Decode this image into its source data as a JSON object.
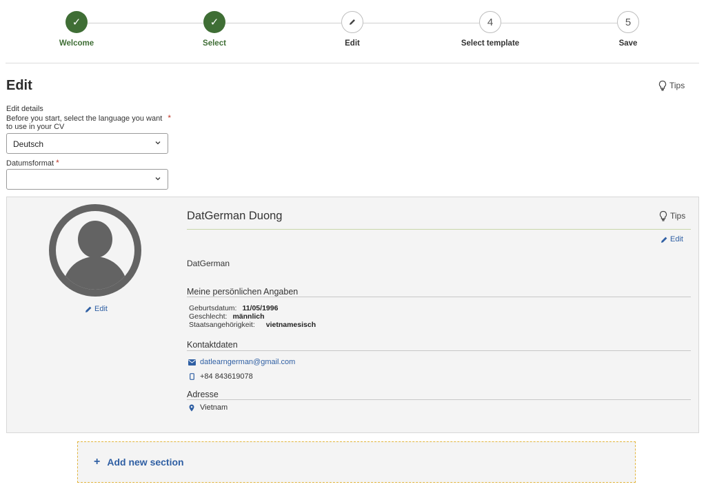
{
  "stepper": {
    "steps": [
      {
        "label": "Welcome",
        "state": "done",
        "symbol": "✓"
      },
      {
        "label": "Select",
        "state": "done",
        "symbol": "✓"
      },
      {
        "label": "Edit",
        "state": "active",
        "symbol": "pencil-icon"
      },
      {
        "label": "Select template",
        "state": "todo",
        "symbol": "4"
      },
      {
        "label": "Save",
        "state": "todo",
        "symbol": "5"
      }
    ]
  },
  "page": {
    "title": "Edit",
    "tips_label": "Tips"
  },
  "form": {
    "edit_details_label": "Edit details",
    "language_prompt_line1": "Before you start, select the language you want",
    "language_prompt_line2": "to use in your CV",
    "required_marker": "*",
    "language_value": "Deutsch",
    "date_format_label": "Datumsformat",
    "date_format_value": ""
  },
  "profile": {
    "name": "DatGerman Duong",
    "tips_label": "Tips",
    "edit_label": "Edit",
    "photo_edit_label": "Edit",
    "nickname": "DatGerman",
    "personal": {
      "heading": "Meine persönlichen Angaben",
      "birth_label": "Geburtsdatum:",
      "birth_value": "11/05/1996",
      "gender_label": "Geschlecht:",
      "gender_value": "männlich",
      "nationality_label": "Staatsangehörigkeit:",
      "nationality_value": "vietnamesisch"
    },
    "contact": {
      "heading": "Kontaktdaten",
      "email": "datlearngerman@gmail.com",
      "phone": "+84 843619078"
    },
    "address": {
      "heading": "Adresse",
      "country": "Vietnam"
    }
  },
  "add_section": {
    "plus": "+",
    "label": "Add new section"
  },
  "colors": {
    "step_done": "#3f6e35",
    "link": "#2f5fa3",
    "dashed_border": "#e2b43a"
  }
}
